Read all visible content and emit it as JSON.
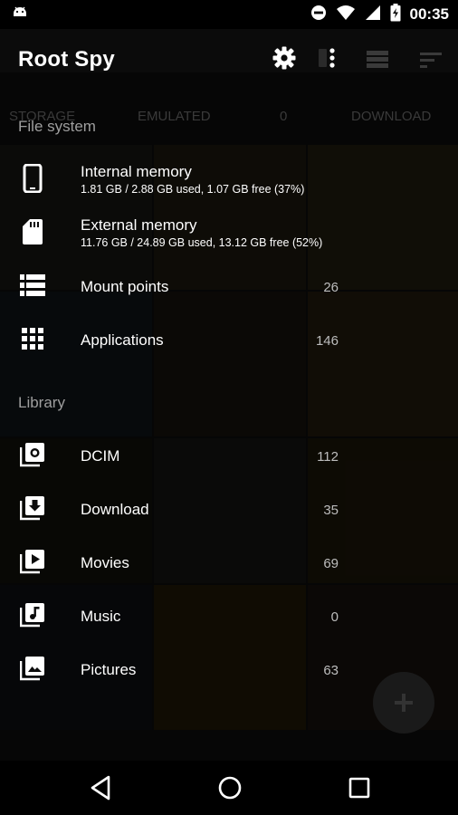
{
  "status_bar": {
    "time": "00:35",
    "icons": [
      "android-icon",
      "do-not-disturb-icon",
      "wifi-icon",
      "signal-icon",
      "battery-charging-icon"
    ]
  },
  "app_bar": {
    "title": "Root Spy",
    "actions": [
      "settings-icon",
      "more-vert-icon"
    ]
  },
  "background_tabs": [
    "STORAGE",
    "EMULATED",
    "0",
    "DOWNLOAD"
  ],
  "drawer": {
    "sections": [
      {
        "title": "File system",
        "items": [
          {
            "icon": "phone-icon",
            "label": "Internal memory",
            "detail": "1.81 GB / 2.88 GB used, 1.07 GB free (37%)"
          },
          {
            "icon": "sd-card-icon",
            "label": "External memory",
            "detail": "11.76 GB / 24.89 GB used, 13.12 GB free (52%)"
          },
          {
            "icon": "list-icon",
            "label": "Mount points",
            "count": "26"
          },
          {
            "icon": "apps-grid-icon",
            "label": "Applications",
            "count": "146"
          }
        ]
      },
      {
        "title": "Library",
        "items": [
          {
            "icon": "camera-library-icon",
            "label": "DCIM",
            "count": "112"
          },
          {
            "icon": "download-library-icon",
            "label": "Download",
            "count": "35"
          },
          {
            "icon": "video-library-icon",
            "label": "Movies",
            "count": "69"
          },
          {
            "icon": "music-library-icon",
            "label": "Music",
            "count": "0"
          },
          {
            "icon": "photo-library-icon",
            "label": "Pictures",
            "count": "63"
          }
        ]
      }
    ]
  },
  "colors": {
    "background": "#0b0b0b",
    "section_title": "#9e9e9e",
    "count": "#bdbdbd",
    "text": "#ffffff"
  }
}
